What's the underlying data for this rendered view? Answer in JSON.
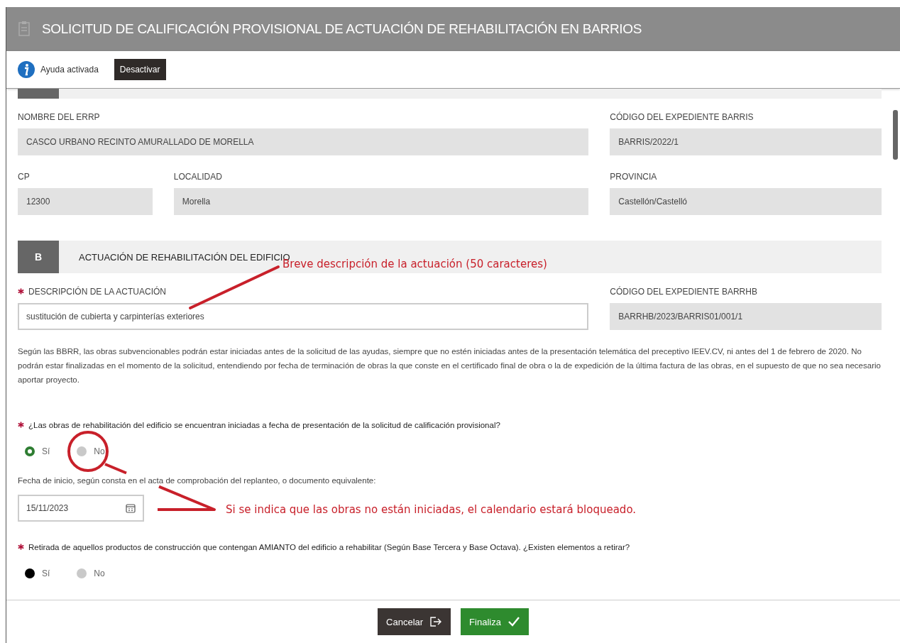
{
  "window": {
    "title": "SOLICITUD DE CALIFICACIÓN PROVISIONAL DE ACTUACIÓN DE REHABILITACIÓN EN BARRIOS"
  },
  "help_bar": {
    "label": "Ayuda activada",
    "button": "Desactivar"
  },
  "section_a": {
    "rows": [
      {
        "fields": [
          {
            "label": "NOMBRE DEL ERRP",
            "value": "CASCO URBANO RECINTO AMURALLADO DE MORELLA"
          },
          {
            "label": "CÓDIGO DEL EXPEDIENTE BARRIS",
            "value": "BARRIS/2022/1"
          }
        ]
      },
      {
        "fields": [
          {
            "label": "CP",
            "value": "12300"
          },
          {
            "label": "LOCALIDAD",
            "value": "Morella"
          },
          {
            "label": "PROVINCIA",
            "value": "Castellón/Castelló"
          }
        ]
      }
    ]
  },
  "section_b": {
    "letter": "B",
    "title": "ACTUACIÓN DE REHABILITACIÓN DEL EDIFICIO",
    "description": {
      "label": "DESCRIPCIÓN DE LA ACTUACIÓN",
      "required": true,
      "value": "sustitución de cubierta y carpinterías exteriores"
    },
    "code": {
      "label": "CÓDIGO DEL EXPEDIENTE BARRHB",
      "value": "BARRHB/2023/BARRIS01/001/1"
    },
    "note": "Según las BBRR, las obras subvencionables podrán estar iniciadas antes de la solicitud de las ayudas, siempre que no estén iniciadas antes de la presentación telemática del preceptivo IEEV.CV, ni antes del 1 de febrero de 2020. No podrán estar finalizadas en el momento de la solicitud, entendiendo por fecha de terminación de obras la que conste en el certificado final de obra o la de expedición de la última factura de las obras, en el supuesto de que no sea necesario aportar proyecto.",
    "questions": [
      {
        "text": "¿Las obras de rehabilitación del edificio se encuentran iniciadas a fecha de presentación de la solicitud de calificación provisional?",
        "required": true,
        "kind": "ring",
        "options": [
          {
            "label": "Sí",
            "selected": true
          },
          {
            "label": "No",
            "selected": false
          }
        ],
        "date": {
          "label": "Fecha de inicio, según consta en el acta de comprobación del replanteo, o documento equivalente:",
          "value": "15/11/2023"
        }
      },
      {
        "text": "Retirada de aquellos productos de construcción que contengan AMIANTO del edificio a rehabilitar (Según Base Tercera y Base Octava). ¿Existen elementos a retirar?",
        "required": true,
        "kind": "solid",
        "options": [
          {
            "label": "Sí",
            "selected": true
          },
          {
            "label": "No",
            "selected": false
          }
        ]
      }
    ]
  },
  "annotations": [
    "Breve descripción de la actuación (50 caracteres)",
    "Si se indica que las obras no están iniciadas, el calendario estará bloqueado."
  ],
  "footer": {
    "buttons": [
      {
        "label": "Cancelar",
        "kind": "cancel"
      },
      {
        "label": "Finaliza",
        "kind": "confirm"
      }
    ]
  }
}
